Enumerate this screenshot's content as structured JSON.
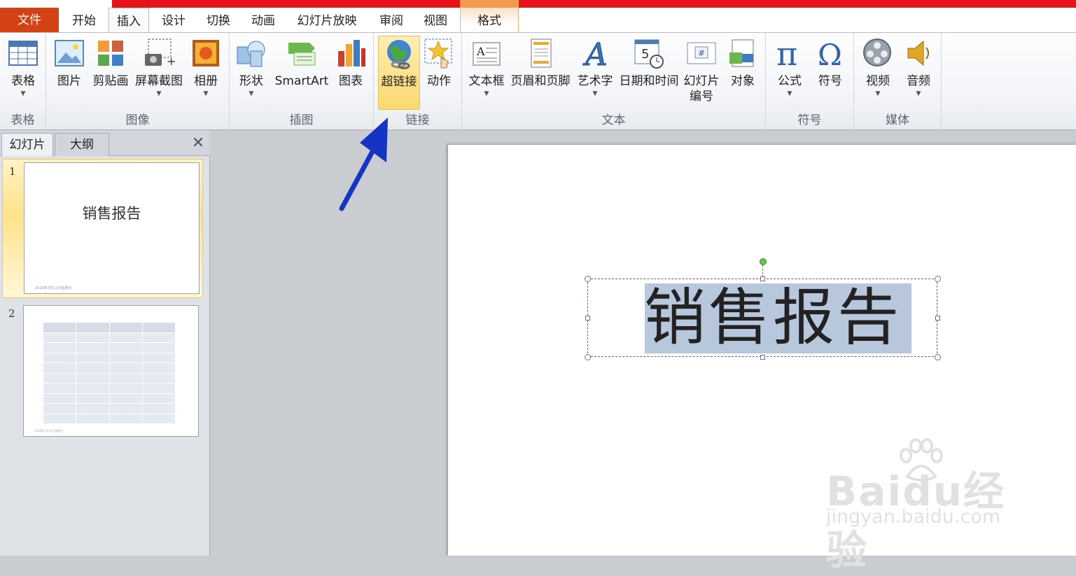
{
  "tabs": {
    "file": "文件",
    "home": "开始",
    "insert": "插入",
    "design": "设计",
    "transitions": "切换",
    "animations": "动画",
    "slideshow": "幻灯片放映",
    "review": "审阅",
    "view": "视图",
    "format": "格式"
  },
  "ribbon": {
    "groups": {
      "tables": "表格",
      "images": "图像",
      "illustrations": "插图",
      "links": "链接",
      "text": "文本",
      "symbols": "符号",
      "media": "媒体"
    },
    "buttons": {
      "table": "表格",
      "picture": "图片",
      "clipart": "剪贴画",
      "screenshot": "屏幕截图",
      "album": "相册",
      "shapes": "形状",
      "smartart": "SmartArt",
      "chart": "图表",
      "hyperlink": "超链接",
      "action": "动作",
      "textbox": "文本框",
      "header_footer": "页眉和页脚",
      "wordart": "艺术字",
      "datetime": "日期和时间",
      "slide_number_1": "幻灯片",
      "slide_number_2": "编号",
      "object": "对象",
      "equation": "公式",
      "symbol": "符号",
      "video": "视频",
      "audio": "音频"
    }
  },
  "pane": {
    "tab_slides": "幻灯片",
    "tab_outline": "大纲",
    "close": "✕",
    "slide1_num": "1",
    "slide1_title": "销售报告",
    "slide1_date": "2020年7月12日星期日",
    "slide2_num": "2",
    "slide2_date": "2020年7月12日星期日"
  },
  "slide": {
    "title": "销售报告"
  },
  "watermark": {
    "brand": "Baidu经验",
    "url": "jingyan.baidu.com"
  },
  "colors": {
    "file_tab": "#d34215",
    "title_bar": "#e8131a",
    "highlight": "#fbd870",
    "arrow": "#1534c4",
    "selection": "#b7c8dc"
  }
}
